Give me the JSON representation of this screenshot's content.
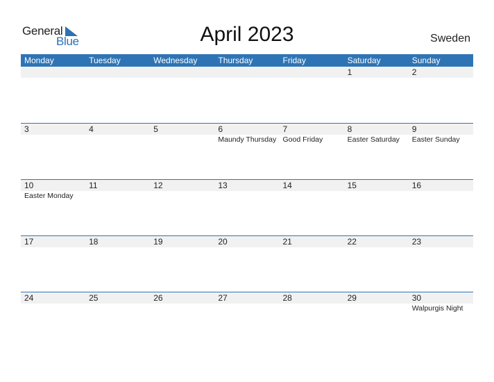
{
  "logo": {
    "line1": "General",
    "line2": "Blue"
  },
  "title": "April 2023",
  "country": "Sweden",
  "colors": {
    "accent": "#2e74b5",
    "strip": "#f1f1f1"
  },
  "weekdays": [
    "Monday",
    "Tuesday",
    "Wednesday",
    "Thursday",
    "Friday",
    "Saturday",
    "Sunday"
  ],
  "weeks": [
    [
      {
        "day": "",
        "holiday": ""
      },
      {
        "day": "",
        "holiday": ""
      },
      {
        "day": "",
        "holiday": ""
      },
      {
        "day": "",
        "holiday": ""
      },
      {
        "day": "",
        "holiday": ""
      },
      {
        "day": "1",
        "holiday": ""
      },
      {
        "day": "2",
        "holiday": ""
      }
    ],
    [
      {
        "day": "3",
        "holiday": ""
      },
      {
        "day": "4",
        "holiday": ""
      },
      {
        "day": "5",
        "holiday": ""
      },
      {
        "day": "6",
        "holiday": "Maundy Thursday"
      },
      {
        "day": "7",
        "holiday": "Good Friday"
      },
      {
        "day": "8",
        "holiday": "Easter Saturday"
      },
      {
        "day": "9",
        "holiday": "Easter Sunday"
      }
    ],
    [
      {
        "day": "10",
        "holiday": "Easter Monday"
      },
      {
        "day": "11",
        "holiday": ""
      },
      {
        "day": "12",
        "holiday": ""
      },
      {
        "day": "13",
        "holiday": ""
      },
      {
        "day": "14",
        "holiday": ""
      },
      {
        "day": "15",
        "holiday": ""
      },
      {
        "day": "16",
        "holiday": ""
      }
    ],
    [
      {
        "day": "17",
        "holiday": ""
      },
      {
        "day": "18",
        "holiday": ""
      },
      {
        "day": "19",
        "holiday": ""
      },
      {
        "day": "20",
        "holiday": ""
      },
      {
        "day": "21",
        "holiday": ""
      },
      {
        "day": "22",
        "holiday": ""
      },
      {
        "day": "23",
        "holiday": ""
      }
    ],
    [
      {
        "day": "24",
        "holiday": ""
      },
      {
        "day": "25",
        "holiday": ""
      },
      {
        "day": "26",
        "holiday": ""
      },
      {
        "day": "27",
        "holiday": ""
      },
      {
        "day": "28",
        "holiday": ""
      },
      {
        "day": "29",
        "holiday": ""
      },
      {
        "day": "30",
        "holiday": "Walpurgis Night"
      }
    ]
  ]
}
